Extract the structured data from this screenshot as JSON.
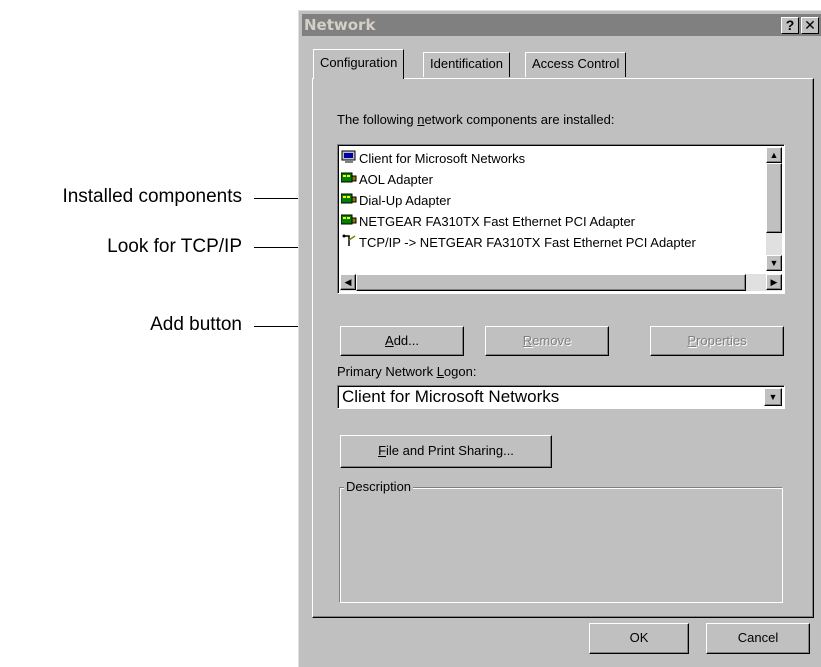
{
  "callouts": {
    "installed": "Installed components",
    "tcpip": "Look for TCP/IP",
    "add": "Add button"
  },
  "window": {
    "title": "Network",
    "help_btn": "?",
    "close_btn": "✕"
  },
  "tabs": [
    {
      "label": "Configuration",
      "active": true
    },
    {
      "label": "Identification",
      "active": false
    },
    {
      "label": "Access Control",
      "active": false
    }
  ],
  "components": {
    "label_pre": "The following ",
    "label_u": "n",
    "label_post": "etwork components are installed:",
    "items": [
      {
        "label": "Client for Microsoft Networks",
        "icon": "client-icon"
      },
      {
        "label": "AOL Adapter",
        "icon": "adapter-icon"
      },
      {
        "label": "Dial-Up Adapter",
        "icon": "adapter-icon"
      },
      {
        "label": "NETGEAR FA310TX Fast Ethernet PCI Adapter",
        "icon": "adapter-icon"
      },
      {
        "label": "TCP/IP -> NETGEAR FA310TX Fast Ethernet PCI Adapter",
        "icon": "protocol-icon"
      }
    ]
  },
  "buttons": {
    "add_u": "A",
    "add_rest": "dd...",
    "remove_u": "R",
    "remove_rest": "emove",
    "properties_u": "P",
    "properties_rest": "roperties",
    "file_print_u": "F",
    "file_print_rest": "ile and Print Sharing...",
    "ok": "OK",
    "cancel": "Cancel"
  },
  "logon": {
    "label_pre": "Primary Network ",
    "label_u": "L",
    "label_post": "ogon:",
    "selected": "Client for Microsoft Networks"
  },
  "description": {
    "title": "Description"
  },
  "colors": {
    "face": "#c0c0c0",
    "titlebar_inactive": "#808080"
  }
}
